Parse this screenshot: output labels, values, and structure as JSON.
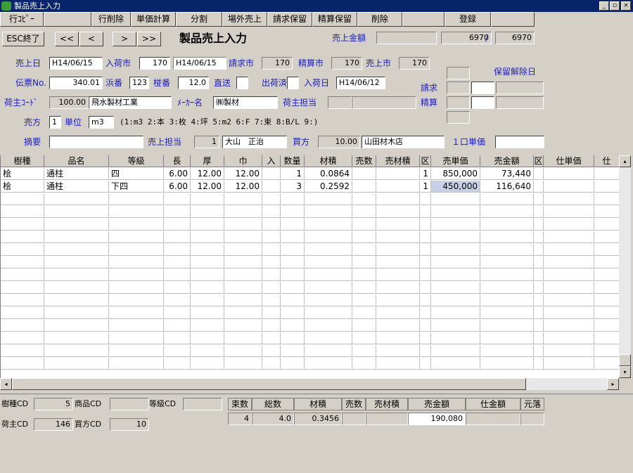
{
  "window": {
    "title": "製品売上入力",
    "minimize": "_",
    "restore": "▫",
    "close": "×"
  },
  "toolbar": [
    "行ｺﾋﾟｰ",
    "",
    "行削除",
    "単価計算",
    "分割",
    "場外売上",
    "請求保留",
    "精算保留",
    "削除",
    "",
    "登録",
    ""
  ],
  "nav": {
    "esc": "ESC終了",
    "first": "<<",
    "prev": "<",
    "next": ">",
    "last": ">>"
  },
  "page_title": "製品売上入力",
  "total": {
    "label": "売上金額",
    "v1": "6970",
    "sep": "/",
    "v2": "6970"
  },
  "row1": {
    "uriagebi_label": "売上日",
    "uriagebi": "H14/06/15",
    "nyukaichi_label": "入荷市",
    "nyukaichi": "170",
    "nyukaichi_date": "H14/06/15",
    "seikyuichi_label": "請求市",
    "seikyuichi": "170",
    "seisanichi_label": "精算市",
    "seisanichi": "170",
    "uriageichi_label": "売上市",
    "uriageichi": "170"
  },
  "row2": {
    "denpyo_label": "伝票No.",
    "denpyo": "340.01",
    "hama_label": "浜番",
    "hama": "123",
    "sao_label": "椪番",
    "sao": "12.0",
    "chokuso_label": "直送",
    "shukka_label": "出荷済",
    "nyukabi_label": "入荷日",
    "nyukabi": "H14/06/12"
  },
  "row3": {
    "ninushi_label": "荷主ｺｰﾄﾞ",
    "ninushi_code": "100.00",
    "ninushi_name": "飛水製材工業",
    "maker_label": "ﾒｰｶｰ名",
    "maker": "㈱製材",
    "tanto_label": "荷主担当",
    "tanto": ""
  },
  "row4": {
    "urikata_label": "売方",
    "urikata": "1",
    "tani_label": "単位",
    "tani": "m3",
    "tani_help": "(1:m3 2:本 3:枚 4:坪 5:m2 6:F 7:束 8:B/L 9:)"
  },
  "row5": {
    "tekiyo_label": "摘要",
    "tekiyo": "",
    "uriage_tanto_label": "売上担当",
    "uriage_tanto_code": "1",
    "uriage_tanto": "大山　正治",
    "kaikata_label": "買方",
    "kaikata_code": "10.00",
    "kaikata": "山田材木店",
    "kuchi_label": "１口単価",
    "kuchi": ""
  },
  "hold": {
    "seikyu_label": "請求",
    "seisan_label": "精算",
    "release_label": "保留解除日"
  },
  "grid": {
    "columns": [
      "樹種",
      "品名",
      "等級",
      "長",
      "厚",
      "巾",
      "入",
      "数量",
      "材積",
      "売数",
      "売材積",
      "区",
      "売単価",
      "売金額",
      "区",
      "仕単価",
      "仕"
    ],
    "rows": [
      [
        "桧",
        "通柱",
        "四",
        "6.00",
        "12.00",
        "12.00",
        "",
        "1",
        "0.0864",
        "",
        "",
        "1",
        "850,000",
        "73,440",
        "",
        "",
        ""
      ],
      [
        "桧",
        "通柱",
        "下四",
        "6.00",
        "12.00",
        "12.00",
        "",
        "3",
        "0.2592",
        "",
        "",
        "1",
        "450,000",
        "116,640",
        "",
        "",
        ""
      ]
    ]
  },
  "bottom": {
    "jushu_cd_label": "樹種CD",
    "jushu_cd": "5",
    "shohin_cd_label": "商品CD",
    "shohin_cd": "",
    "tokyu_cd_label": "等級CD",
    "tokyu_cd": "",
    "ninushi_cd_label": "荷主CD",
    "ninushi_cd": "146",
    "kaikata_cd_label": "買方CD",
    "kaikata_cd": "10",
    "summary_headers": [
      "束数",
      "総数",
      "材積",
      "売数",
      "売材積",
      "売金額",
      "仕金額",
      "元落"
    ],
    "summary_values": [
      "4",
      "4.0",
      "0.3456",
      "",
      "",
      "190,080",
      "",
      ""
    ]
  },
  "scroll": {
    "left": "◂",
    "right": "▸",
    "up": "▴",
    "down": "▾"
  }
}
